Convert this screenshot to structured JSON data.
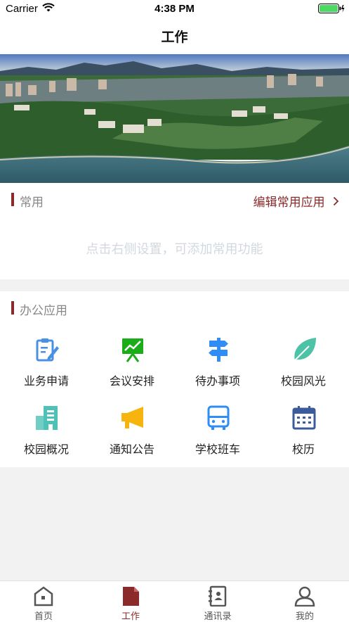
{
  "status": {
    "carrier": "Carrier",
    "time": "4:38 PM"
  },
  "nav": {
    "title": "工作"
  },
  "frequent": {
    "title": "常用",
    "edit_label": "编辑常用应用",
    "empty_hint": "点击右侧设置，可添加常用功能"
  },
  "office": {
    "title": "办公应用",
    "apps": [
      {
        "label": "业务申请",
        "icon": "edit-document-icon",
        "color": "#4a90e2"
      },
      {
        "label": "会议安排",
        "icon": "presentation-board-icon",
        "color": "#1aad19"
      },
      {
        "label": "待办事项",
        "icon": "signpost-icon",
        "color": "#2f8df5"
      },
      {
        "label": "校园风光",
        "icon": "leaf-icon",
        "color": "#4ec2a6"
      },
      {
        "label": "校园概况",
        "icon": "building-icon",
        "color": "#4ec2b6"
      },
      {
        "label": "通知公告",
        "icon": "megaphone-icon",
        "color": "#f5b50e"
      },
      {
        "label": "学校班车",
        "icon": "bus-icon",
        "color": "#2f8df5"
      },
      {
        "label": "校历",
        "icon": "calendar-icon",
        "color": "#3b5b9a"
      }
    ]
  },
  "tabs": [
    {
      "label": "首页",
      "icon": "home-icon"
    },
    {
      "label": "工作",
      "icon": "document-icon",
      "active": true
    },
    {
      "label": "通讯录",
      "icon": "contacts-book-icon"
    },
    {
      "label": "我的",
      "icon": "user-icon"
    }
  ],
  "colors": {
    "accent": "#8b2a2a",
    "background": "#f2f2f2"
  }
}
